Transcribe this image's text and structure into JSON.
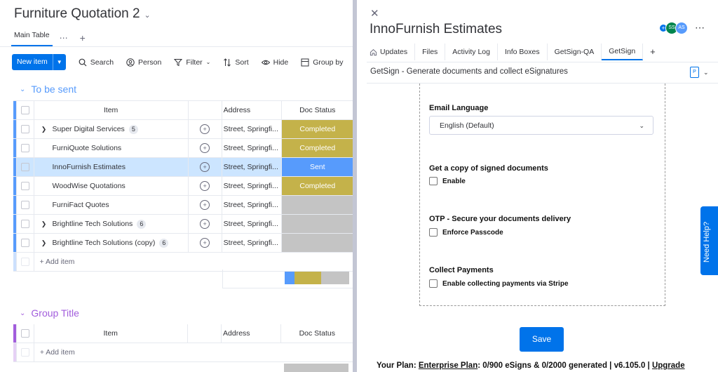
{
  "board": {
    "title": "Furniture Quotation 2",
    "view_tab": "Main Table",
    "toolbar": {
      "new_item": "New item",
      "search": "Search",
      "person": "Person",
      "filter": "Filter",
      "sort": "Sort",
      "hide": "Hide",
      "group_by": "Group by"
    },
    "groups": [
      {
        "title": "To be sent",
        "color": "#579bfc",
        "columns": {
          "item": "Item",
          "address": "Address",
          "doc_status": "Doc Status"
        },
        "rows": [
          {
            "name": "Super Digital Services",
            "count": "5",
            "address": "Street, Springfi...",
            "status": "Completed",
            "status_color": "#c4b24a"
          },
          {
            "name": "FurniQuote Solutions",
            "count": "",
            "address": "Street, Springfi...",
            "status": "Completed",
            "status_color": "#c4b24a"
          },
          {
            "name": "InnoFurnish Estimates",
            "count": "",
            "address": "Street, Springfi...",
            "status": "Sent",
            "status_color": "#579bfc"
          },
          {
            "name": "WoodWise Quotations",
            "count": "",
            "address": "Street, Springfi...",
            "status": "Completed",
            "status_color": "#c4b24a"
          },
          {
            "name": "FurniFact Quotes",
            "count": "",
            "address": "Street, Springfi...",
            "status": "",
            "status_color": "#c4c4c4"
          },
          {
            "name": "Brightline Tech Solutions",
            "count": "6",
            "address": "Street, Springfi...",
            "status": "",
            "status_color": "#c4c4c4"
          },
          {
            "name": "Brightline Tech Solutions (copy)",
            "count": "6",
            "address": "Street, Springfi...",
            "status": "",
            "status_color": "#c4c4c4"
          }
        ],
        "add_item": "+ Add item"
      },
      {
        "title": "Group Title",
        "color": "#a25ddc",
        "columns": {
          "item": "Item",
          "address": "Address",
          "doc_status": "Doc Status"
        },
        "add_item": "+ Add item"
      }
    ]
  },
  "panel": {
    "title": "InnoFurnish Estimates",
    "avatars": [
      "SS",
      "AS"
    ],
    "tabs": [
      "Updates",
      "Files",
      "Activity Log",
      "Info Boxes",
      "GetSign-QA",
      "GetSign"
    ],
    "active_tab": "GetSign",
    "getsign_header": "GetSign - Generate documents and collect eSignatures",
    "email_language_label": "Email Language",
    "email_language_value": "English (Default)",
    "copy_label": "Get a copy of signed documents",
    "copy_option": "Enable",
    "otp_label": "OTP - Secure your documents delivery",
    "otp_option": "Enforce Passcode",
    "payments_label": "Collect Payments",
    "payments_option": "Enable collecting payments via Stripe",
    "save": "Save",
    "plan_prefix": "Your Plan:",
    "plan_name": "Enterprise Plan",
    "plan_details": ": 0/900 eSigns & 0/2000 generated | v6.105.0 |",
    "upgrade": "Upgrade",
    "help": "Need Help?"
  }
}
